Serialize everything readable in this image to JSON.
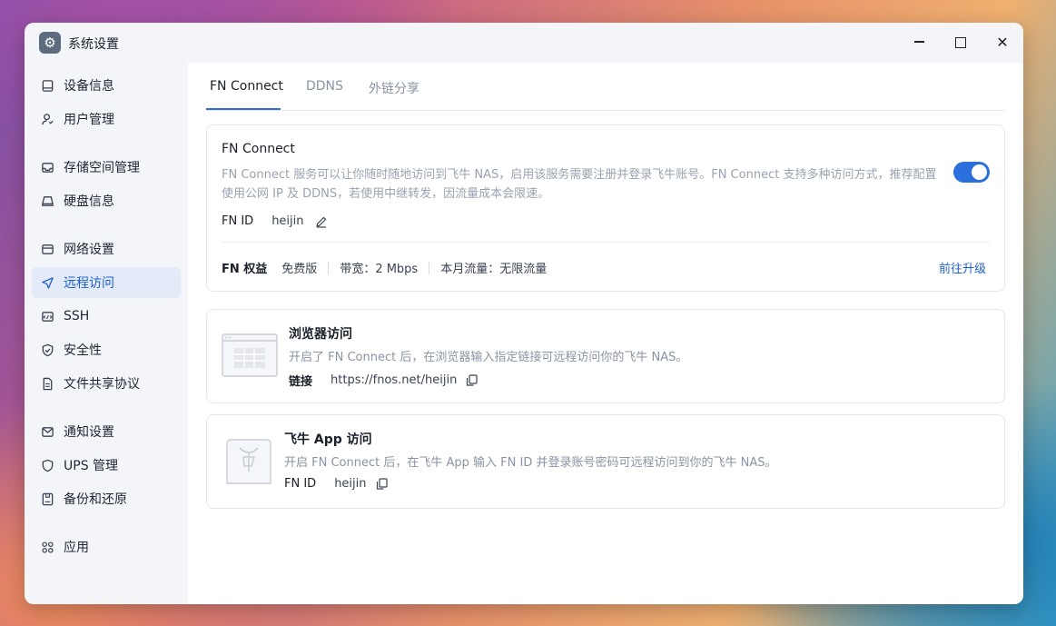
{
  "window": {
    "title": "系统设置",
    "icon": "gear-icon"
  },
  "sidebar": {
    "items": [
      {
        "label": "设备信息",
        "icon": "device-info-icon"
      },
      {
        "label": "用户管理",
        "icon": "user-icon"
      },
      {
        "label": "存储空间管理",
        "icon": "storage-icon"
      },
      {
        "label": "硬盘信息",
        "icon": "disk-icon"
      },
      {
        "label": "网络设置",
        "icon": "network-icon"
      },
      {
        "label": "远程访问",
        "icon": "send-icon",
        "active": true
      },
      {
        "label": "SSH",
        "icon": "terminal-icon"
      },
      {
        "label": "安全性",
        "icon": "shield-check-icon"
      },
      {
        "label": "文件共享协议",
        "icon": "file-icon"
      },
      {
        "label": "通知设置",
        "icon": "mail-icon"
      },
      {
        "label": "UPS 管理",
        "icon": "shield-icon"
      },
      {
        "label": "备份和还原",
        "icon": "backup-icon"
      },
      {
        "label": "应用",
        "icon": "apps-icon"
      }
    ]
  },
  "tabs": [
    {
      "label": "FN Connect",
      "active": true
    },
    {
      "label": "DDNS"
    },
    {
      "label": "外链分享"
    }
  ],
  "fn_connect": {
    "title": "FN Connect",
    "description": "FN Connect 服务可以让你随时随地访问到飞牛 NAS，启用该服务需要注册并登录飞牛账号。FN Connect 支持多种访问方式，推荐配置使用公网 IP 及 DDNS，若使用中继转发，因流量成本会限速。",
    "enabled": true,
    "id_label": "FN ID",
    "id_value": "heijin",
    "benefits_label": "FN 权益",
    "plan": "免费版",
    "bandwidth": "带宽：2 Mbps",
    "traffic": "本月流量：无限流量",
    "upgrade": "前往升级"
  },
  "browser_access": {
    "title": "浏览器访问",
    "description": "开启了 FN Connect 后，在浏览器输入指定链接可远程访问你的飞牛 NAS。",
    "link_label": "链接",
    "link_value": "https://fnos.net/heijin"
  },
  "app_access": {
    "title": "飞牛 App 访问",
    "description": "开启 FN Connect 后，在飞牛 App 输入 FN ID 并登录账号密码可远程访问到你的飞牛 NAS。",
    "id_label": "FN ID",
    "id_value": "heijin"
  },
  "colors": {
    "accent": "#2a6fdb",
    "active_bg": "#e3ebf9",
    "muted_text": "#9aa2b1"
  }
}
